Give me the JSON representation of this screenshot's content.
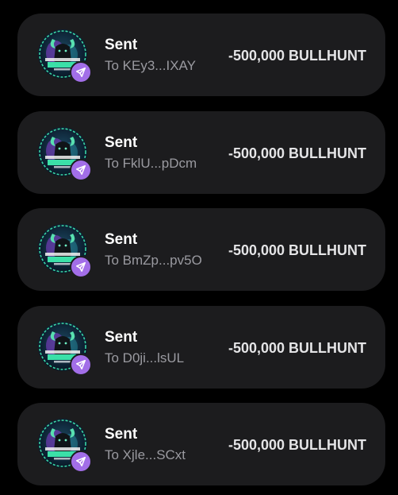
{
  "colors": {
    "background": "#000000",
    "card": "#1c1c1e",
    "badge": "#a26ee8",
    "title": "#ffffff",
    "subtitle": "#9a9aa0",
    "amount": "#e4e4e6"
  },
  "token_logo": {
    "icon": "bull-hunter-token-logo",
    "text": "THE BLACK HUNT"
  },
  "transactions": [
    {
      "title": "Sent",
      "recipient": "To KEy3...IXAY",
      "amount": "-500,000 BULLHUNT",
      "badge_icon": "send-icon"
    },
    {
      "title": "Sent",
      "recipient": "To FklU...pDcm",
      "amount": "-500,000 BULLHUNT",
      "badge_icon": "send-icon"
    },
    {
      "title": "Sent",
      "recipient": "To BmZp...pv5O",
      "amount": "-500,000 BULLHUNT",
      "badge_icon": "send-icon"
    },
    {
      "title": "Sent",
      "recipient": "To D0ji...lsUL",
      "amount": "-500,000 BULLHUNT",
      "badge_icon": "send-icon"
    },
    {
      "title": "Sent",
      "recipient": "To Xjle...SCxt",
      "amount": "-500,000 BULLHUNT",
      "badge_icon": "send-icon"
    }
  ]
}
